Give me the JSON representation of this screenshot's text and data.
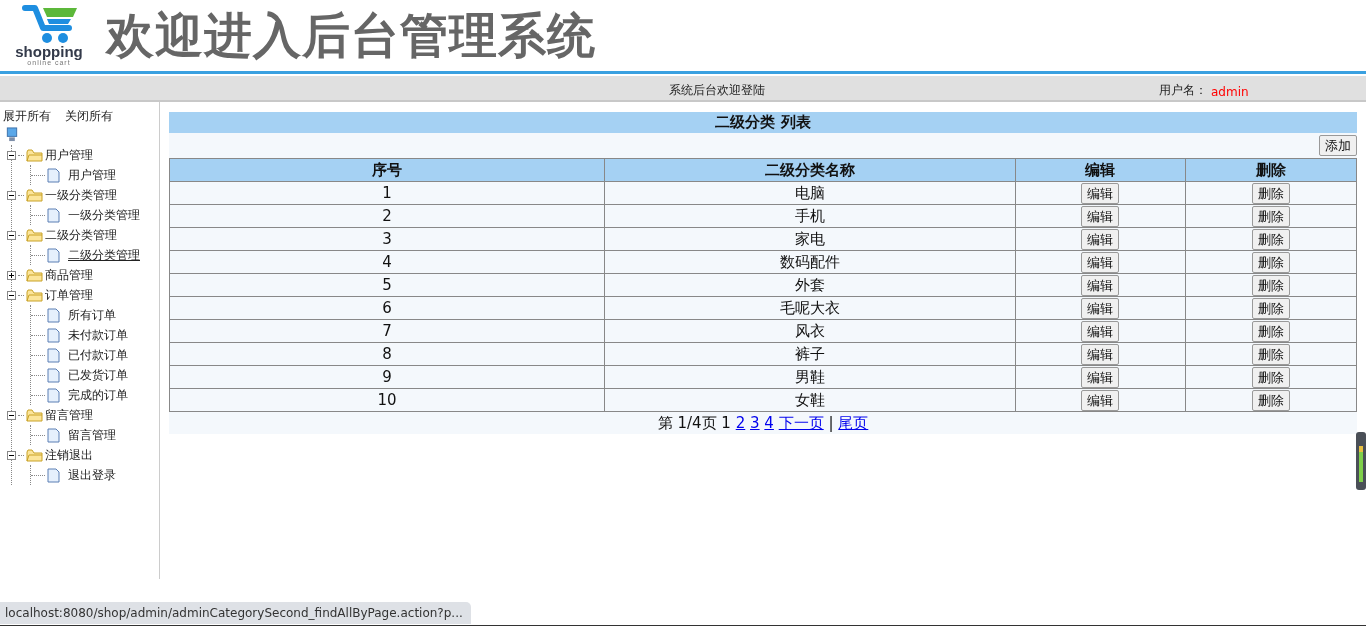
{
  "header": {
    "logo": {
      "wordmark": "shopping",
      "tagline": "online cart"
    },
    "title": "欢迎进入后台管理系统"
  },
  "nav_bar": {
    "welcome": "系统后台欢迎登陆",
    "user_label": "用户名：",
    "user_name": "admin"
  },
  "sidebar": {
    "expand_all": "展开所有",
    "collapse_all": "关闭所有",
    "tree": [
      {
        "label": "用户管理",
        "expanded": true,
        "children": [
          {
            "label": "用户管理",
            "selected": false
          }
        ]
      },
      {
        "label": "一级分类管理",
        "expanded": true,
        "children": [
          {
            "label": "一级分类管理",
            "selected": false
          }
        ]
      },
      {
        "label": "二级分类管理",
        "expanded": true,
        "children": [
          {
            "label": "二级分类管理",
            "selected": true
          }
        ]
      },
      {
        "label": "商品管理",
        "expanded": false
      },
      {
        "label": "订单管理",
        "expanded": true,
        "children": [
          {
            "label": "所有订单",
            "selected": false
          },
          {
            "label": "未付款订单",
            "selected": false
          },
          {
            "label": "已付款订单",
            "selected": false
          },
          {
            "label": "已发货订单",
            "selected": false
          },
          {
            "label": "完成的订单",
            "selected": false
          }
        ]
      },
      {
        "label": "留言管理",
        "expanded": true,
        "children": [
          {
            "label": "留言管理",
            "selected": false
          }
        ]
      },
      {
        "label": "注销退出",
        "expanded": true,
        "children": [
          {
            "label": "退出登录",
            "selected": false
          }
        ]
      }
    ]
  },
  "panel": {
    "title": "二级分类 列表",
    "add_button": "添加",
    "table": {
      "columns": [
        "序号",
        "二级分类名称",
        "编辑",
        "删除"
      ],
      "rows": [
        {
          "index": "1",
          "name": "电脑",
          "edit": "编辑",
          "delete": "删除"
        },
        {
          "index": "2",
          "name": "手机",
          "edit": "编辑",
          "delete": "删除"
        },
        {
          "index": "3",
          "name": "家电",
          "edit": "编辑",
          "delete": "删除"
        },
        {
          "index": "4",
          "name": "数码配件",
          "edit": "编辑",
          "delete": "删除"
        },
        {
          "index": "5",
          "name": "外套",
          "edit": "编辑",
          "delete": "删除"
        },
        {
          "index": "6",
          "name": "毛呢大衣",
          "edit": "编辑",
          "delete": "删除"
        },
        {
          "index": "7",
          "name": "风衣",
          "edit": "编辑",
          "delete": "删除"
        },
        {
          "index": "8",
          "name": "裤子",
          "edit": "编辑",
          "delete": "删除"
        },
        {
          "index": "9",
          "name": "男鞋",
          "edit": "编辑",
          "delete": "删除"
        },
        {
          "index": "10",
          "name": "女鞋",
          "edit": "编辑",
          "delete": "删除"
        }
      ]
    },
    "pagination": [
      {
        "kind": "text",
        "text": "第 1/4页 1"
      },
      {
        "kind": "link",
        "text": "2"
      },
      {
        "kind": "link",
        "text": "3"
      },
      {
        "kind": "link",
        "text": "4"
      },
      {
        "kind": "link",
        "text": "下一页"
      },
      {
        "kind": "text",
        "text": "|"
      },
      {
        "kind": "link",
        "text": "尾页"
      }
    ]
  },
  "status_bar": {
    "url": "localhost:8080/shop/admin/adminCategorySecond_findAllByPage.action?p..."
  }
}
